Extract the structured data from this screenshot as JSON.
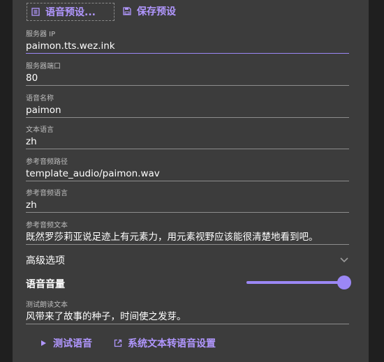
{
  "toolbar": {
    "preset_label": "语音预设...",
    "save_label": "保存预设"
  },
  "fields": [
    {
      "label": "服务器 IP",
      "value": "paimon.tts.wez.ink"
    },
    {
      "label": "服务器端口",
      "value": "80"
    },
    {
      "label": "语音名称",
      "value": "paimon"
    },
    {
      "label": "文本语言",
      "value": "zh"
    },
    {
      "label": "参考音频路径",
      "value": "template_audio/paimon.wav"
    },
    {
      "label": "参考音频语言",
      "value": "zh"
    },
    {
      "label": "参考音频文本",
      "value": "既然罗莎莉亚说足迹上有元素力，用元素视野应该能很清楚地看到吧。"
    }
  ],
  "advanced": {
    "label": "高级选项",
    "icon": "chevron-down-icon"
  },
  "volume": {
    "label": "语音音量",
    "level_percent": 100
  },
  "test_text": {
    "label": "测试朗读文本",
    "value": "风带来了故事的种子，时间使之发芽。"
  },
  "actions": {
    "test_label": "测试语音",
    "system_label": "系统文本转语音设置"
  },
  "colors": {
    "accent": "#9b87f5",
    "panel": "#3c3c3c",
    "background": "#1f1f1f"
  }
}
